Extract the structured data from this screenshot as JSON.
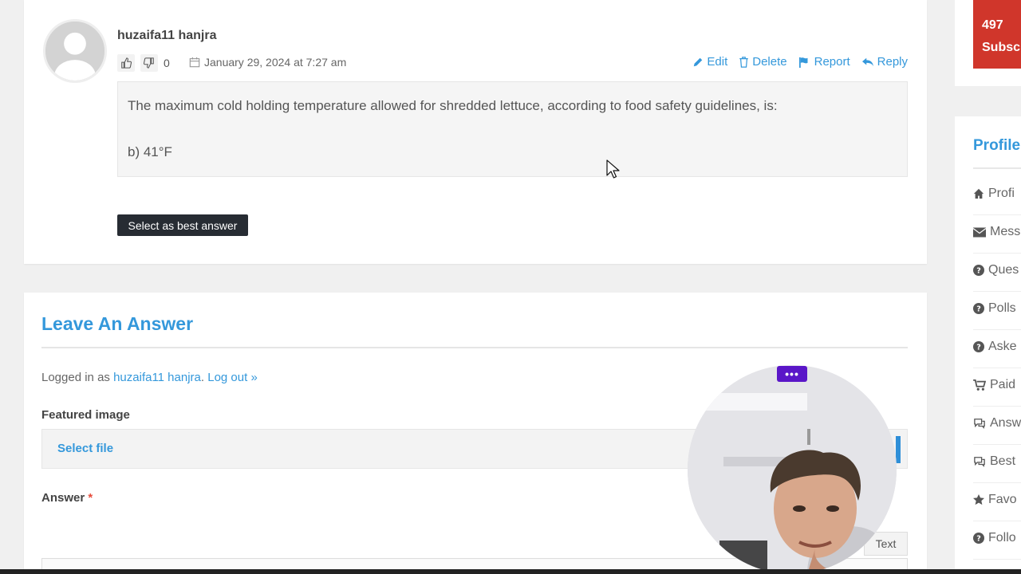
{
  "answer": {
    "author": "huzaifa11 hanjra",
    "vote_count": "0",
    "date": "January 29, 2024 at 7:27 am",
    "actions": {
      "edit": "Edit",
      "delete": "Delete",
      "report": "Report",
      "reply": "Reply"
    },
    "body": [
      "The maximum cold holding temperature allowed for shredded lettuce, according to food safety guidelines, is:",
      "b) 41°F"
    ],
    "best_button": "Select as best answer"
  },
  "leave_answer": {
    "title": "Leave An Answer",
    "logged_in_prefix": "Logged in as ",
    "user_link": "huzaifa11 hanjra",
    "separator": ". ",
    "logout_link": "Log out »",
    "featured_label": "Featured image",
    "select_file": "Select file",
    "answer_label": "Answer",
    "required_mark": "*",
    "editor_tab": "Text"
  },
  "sidebar": {
    "subscribers_count": "497",
    "subscribers_label": "Subsc",
    "profile_title": "Profile",
    "items": [
      {
        "label": "Profi",
        "icon": "home-icon"
      },
      {
        "label": "Mess",
        "icon": "envelope-icon"
      },
      {
        "label": "Ques",
        "icon": "question-circle-icon"
      },
      {
        "label": "Polls",
        "icon": "question-circle-icon"
      },
      {
        "label": "Aske",
        "icon": "question-circle-icon"
      },
      {
        "label": "Paid",
        "icon": "cart-icon"
      },
      {
        "label": "Answ",
        "icon": "comments-icon"
      },
      {
        "label": "Best",
        "icon": "comments-icon"
      },
      {
        "label": "Favo",
        "icon": "star-icon"
      },
      {
        "label": "Follo",
        "icon": "question-circle-icon"
      }
    ]
  },
  "webcam": {
    "menu_label": "•••"
  },
  "colors": {
    "accent": "#3498db",
    "dark_button": "#272c33",
    "subscribe_red": "#d0362b",
    "webcam_menu": "#5a16c8"
  }
}
